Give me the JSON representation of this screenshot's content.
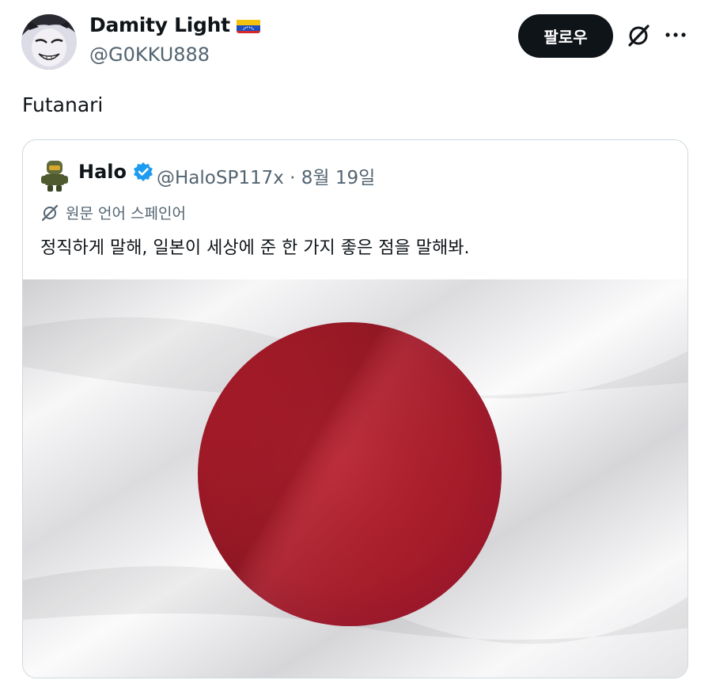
{
  "post": {
    "author_name": "Damity Light",
    "author_handle": "@G0KKU888",
    "follow_label": "팔로우",
    "text": "Futanari"
  },
  "quoted_post": {
    "author_name": "Halo",
    "author_handle": "@HaloSP117x",
    "separator": "·",
    "date": "8월 19일",
    "translate_label": "원문 언어 스페인어",
    "text": "정직하게 말해, 일본이 세상에 준 한 가지 좋은 점을 말해봐."
  },
  "colors": {
    "follow_bg": "#0f1419",
    "secondary_text": "#536471",
    "verified": "#1d9bf0",
    "flag_red": "#b01f2e",
    "card_border": "#cfd9de"
  },
  "icons": {
    "author_flag": "venezuela-flag-icon",
    "grok": "grok-slash-icon",
    "more": "more-dots-icon",
    "verified": "verified-badge-icon",
    "translate": "translate-icon"
  },
  "media": {
    "description_icon": "japan-flag-image"
  }
}
